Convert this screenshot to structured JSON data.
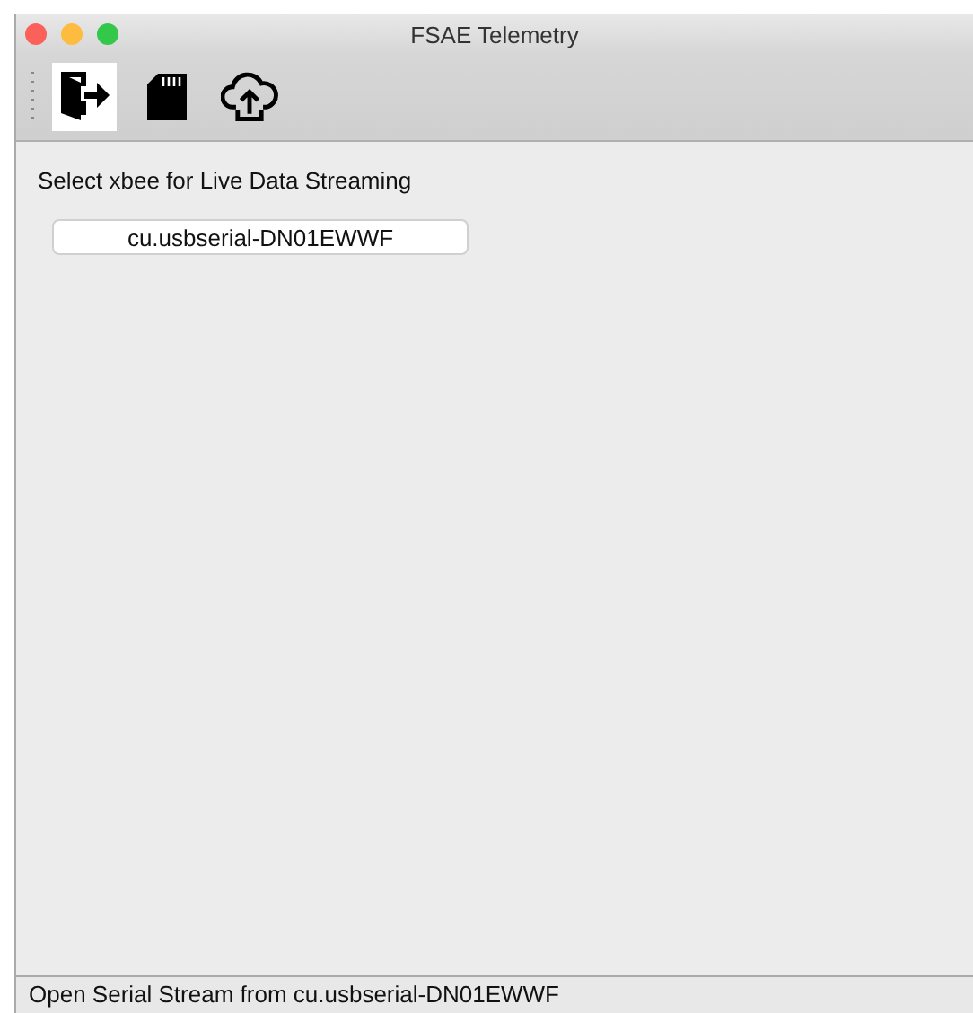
{
  "window": {
    "title": "FSAE Telemetry"
  },
  "toolbar": [
    {
      "kind": "exit",
      "selected": true
    },
    {
      "kind": "sdcard",
      "selected": false
    },
    {
      "kind": "upload",
      "selected": false
    }
  ],
  "content": {
    "label": "Select xbee for Live Data Streaming",
    "device_button": "cu.usbserial-DN01EWWF"
  },
  "status_bar": "Open Serial Stream from cu.usbserial-DN01EWWF"
}
